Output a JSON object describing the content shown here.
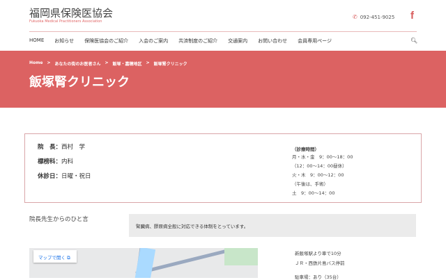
{
  "header": {
    "title": "福岡県保険医協会",
    "subtitle": "Fukuoka Medical Practitioners Association",
    "phone": "092-451-9025",
    "facebook": "f"
  },
  "nav": [
    "HOME",
    "お知らせ",
    "保険医協会のご紹介",
    "入会のご案内",
    "共済制度のご紹介",
    "交通案内",
    "お問い合わせ",
    "会員専用ページ"
  ],
  "breadcrumb": [
    "Home",
    "あなたの街のお医者さん",
    "飯塚・嘉穂地区",
    "飯塚腎クリニック"
  ],
  "breadcrumb_sep": ">",
  "page_title": "飯塚腎クリニック",
  "info": {
    "director_label": "院　長：",
    "director": "西村　学",
    "specialty_label": "標榜科：",
    "specialty": "内科",
    "closed_label": "休診日：",
    "closed": "日曜・祝日",
    "hours": [
      "（診療時間）",
      "月・水・金　9：00〜18：00",
      "（12：00〜14：00昼休）",
      "火・木　9：00〜12：00",
      "（午後は、手術）",
      "土　9：00〜14：00"
    ]
  },
  "message": {
    "label": "院長先生からのひと言",
    "text": "腎臓病、膠原病全般に対応できる体制をとっています。"
  },
  "map": {
    "open_label": "マップで開く ⧉"
  },
  "access": [
    "新飯塚駅より車で10分",
    "ＪＲ・西鉄片島バス停前",
    "駐車場：あり（35台）"
  ]
}
